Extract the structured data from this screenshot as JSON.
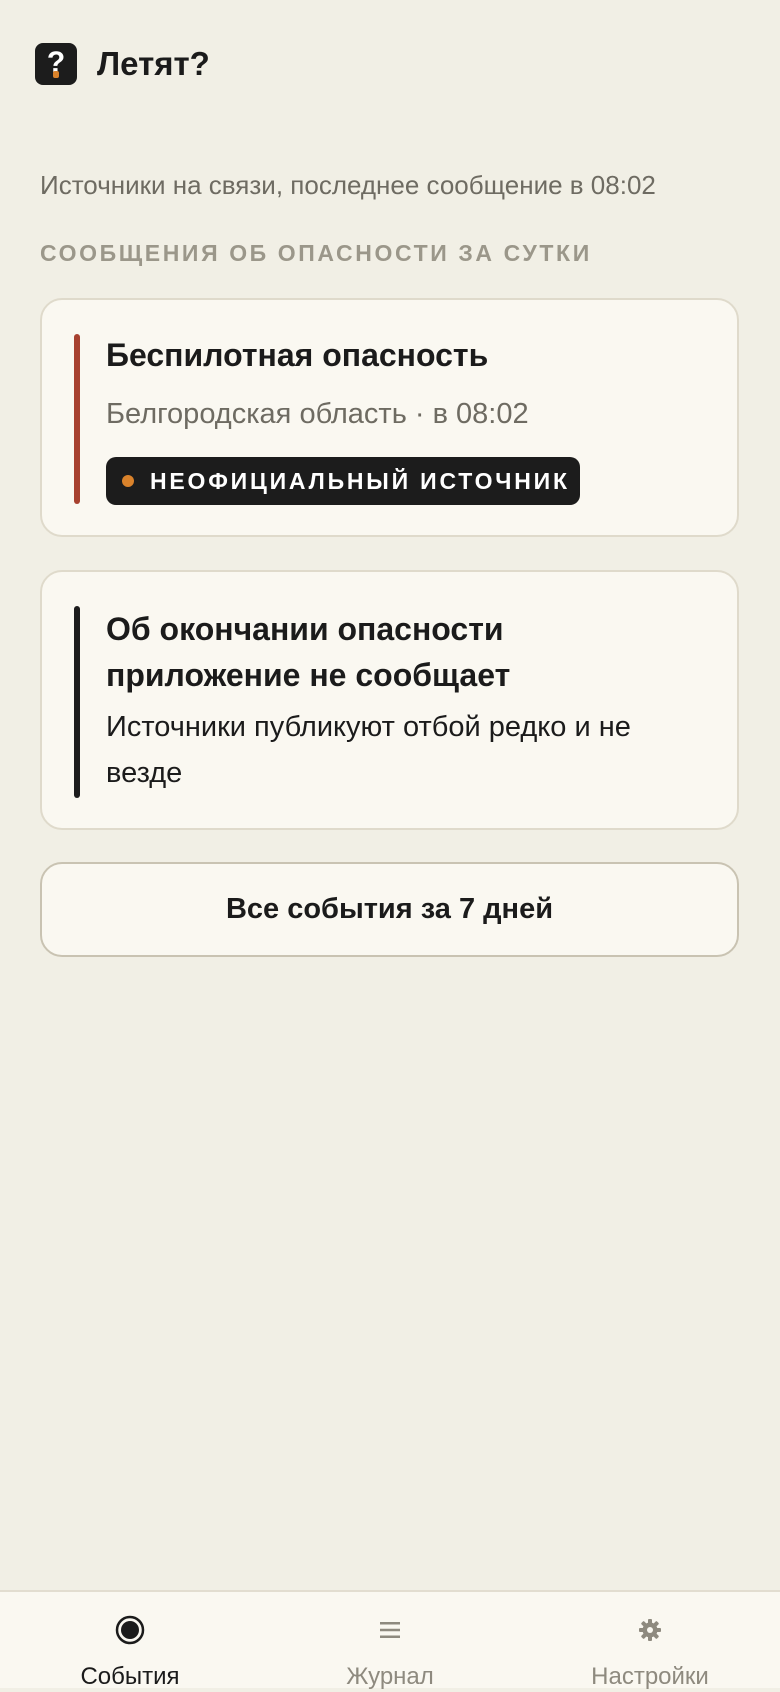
{
  "app": {
    "title": "Летят?",
    "logo_symbol": "?",
    "logo_icon": "question-mark-icon"
  },
  "status": {
    "text": "Источники на связи, последнее сообщение в 08:02"
  },
  "section": {
    "heading": "СООБЩЕНИЯ ОБ ОПАСНОСТИ ЗА СУТКИ"
  },
  "alert_card": {
    "title": "Беспилотная опасность",
    "subtitle": "Белгородская область · в 08:02",
    "badge": "НЕОФИЦИАЛЬНЫЙ ИСТОЧНИК",
    "accent_color": "#A7412F",
    "badge_dot_color": "#D9822B"
  },
  "info_card": {
    "title": "Об окончании опасности приложение не сообщает",
    "body": "Источники публикуют отбой редко и не везде",
    "accent_color": "#1C1C1C"
  },
  "actions": {
    "all_events_label": "Все события за 7 дней"
  },
  "tabs": [
    {
      "label": "События",
      "icon": "radio-dot-icon",
      "active": true
    },
    {
      "label": "Журнал",
      "icon": "menu-lines-icon",
      "active": false
    },
    {
      "label": "Настройки",
      "icon": "gear-icon",
      "active": false
    }
  ],
  "colors": {
    "background": "#F1EFE5",
    "card": "#FAF8F1",
    "text_primary": "#1B1B1B",
    "text_secondary": "#6E6B62",
    "heading_muted": "#9B978A",
    "tab_inactive": "#8E8A7F"
  }
}
